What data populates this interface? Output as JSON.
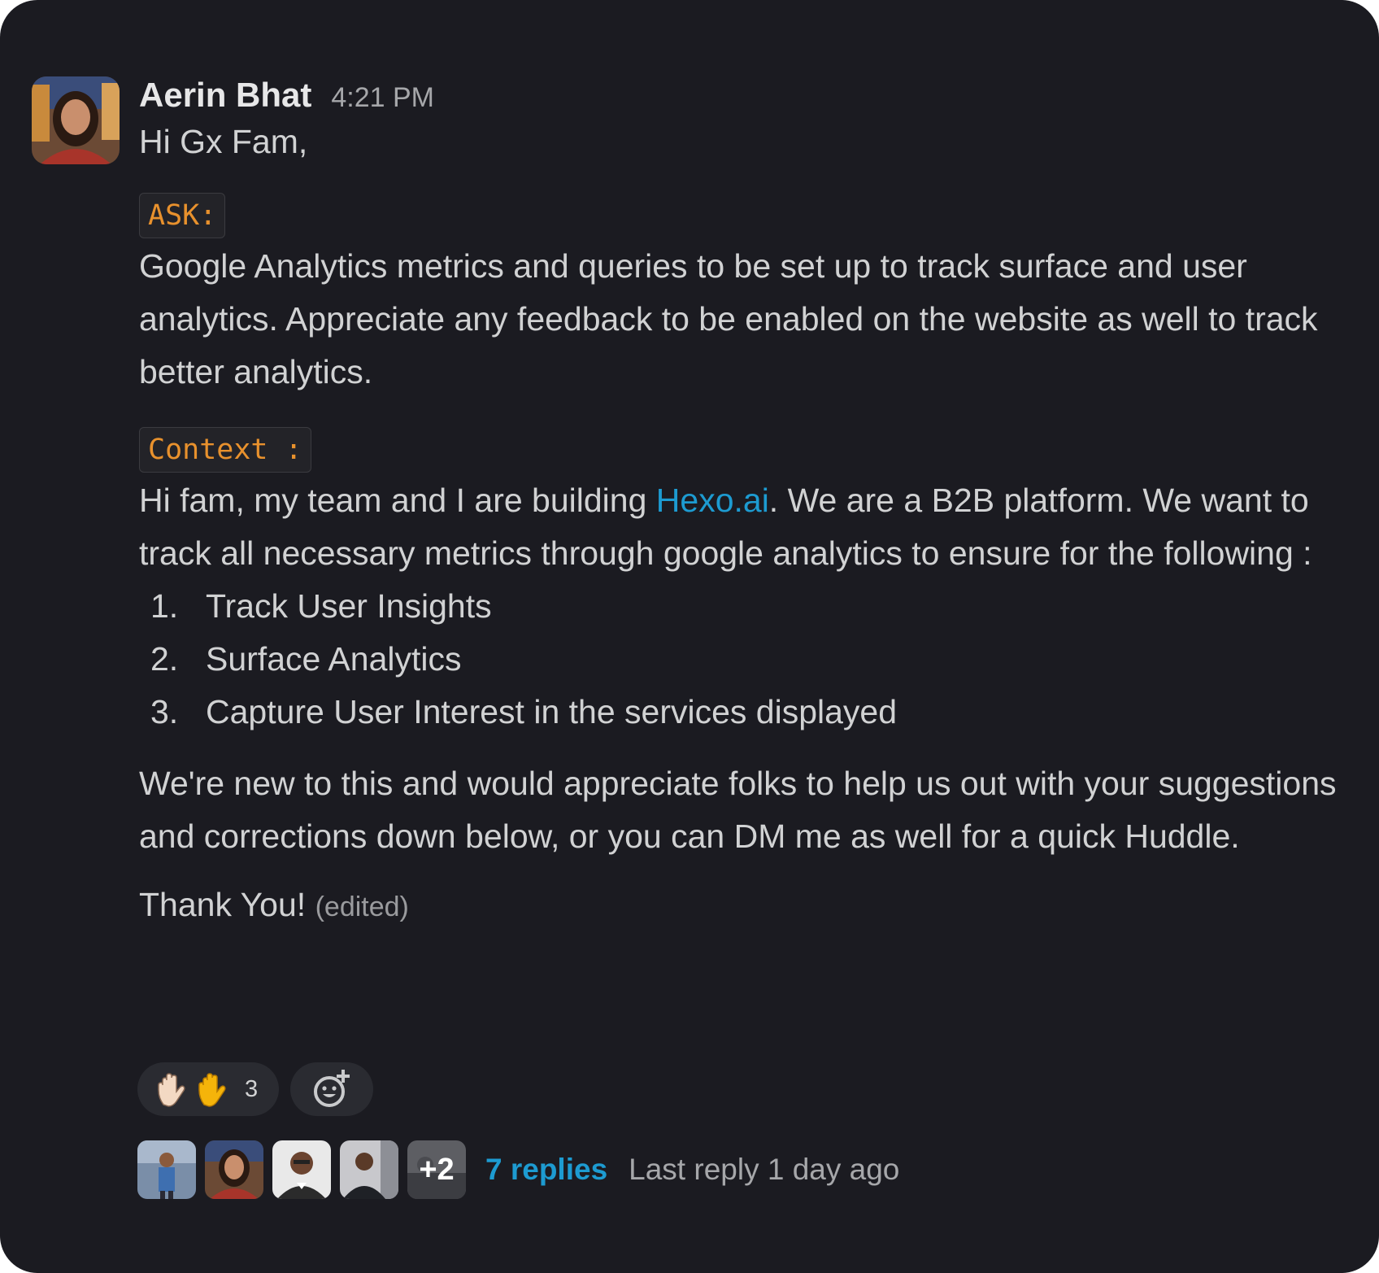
{
  "message": {
    "author": "Aerin Bhat",
    "time": "4:21 PM",
    "greeting": "Hi Gx Fam,",
    "ask_label": "ASK:",
    "ask_text": "Google Analytics metrics and queries to be set up to track surface and user analytics. Appreciate any feedback to be enabled on the website as well to track better analytics.",
    "context_label": "Context :",
    "context_before_link": "Hi fam, my team and I are building ",
    "context_link": "Hexo.ai",
    "context_after_link": ". We are a B2B platform. We want to track all necessary metrics through google analytics to ensure for the following :",
    "list": [
      {
        "num": "1.",
        "text": "Track User Insights"
      },
      {
        "num": "2.",
        "text": "Surface Analytics"
      },
      {
        "num": "3.",
        "text": "Capture User Interest in the services displayed"
      }
    ],
    "closing_text": "We're new to this and would appreciate folks to help us out with your suggestions and corrections down below, or you can DM me as well for a quick Huddle.",
    "thanks": "Thank You!",
    "edited": "(edited)"
  },
  "reactions": {
    "raised_hand_count": "3",
    "icons": [
      "raised-hand-light",
      "raised-hand-yellow",
      "add-reaction"
    ]
  },
  "thread": {
    "more_count": "+2",
    "replies": "7 replies",
    "last_reply": "Last reply 1 day ago"
  },
  "colors": {
    "background": "#1b1b21",
    "text": "#d1d2d3",
    "link": "#1d9bd1",
    "code": "#e8912d"
  }
}
